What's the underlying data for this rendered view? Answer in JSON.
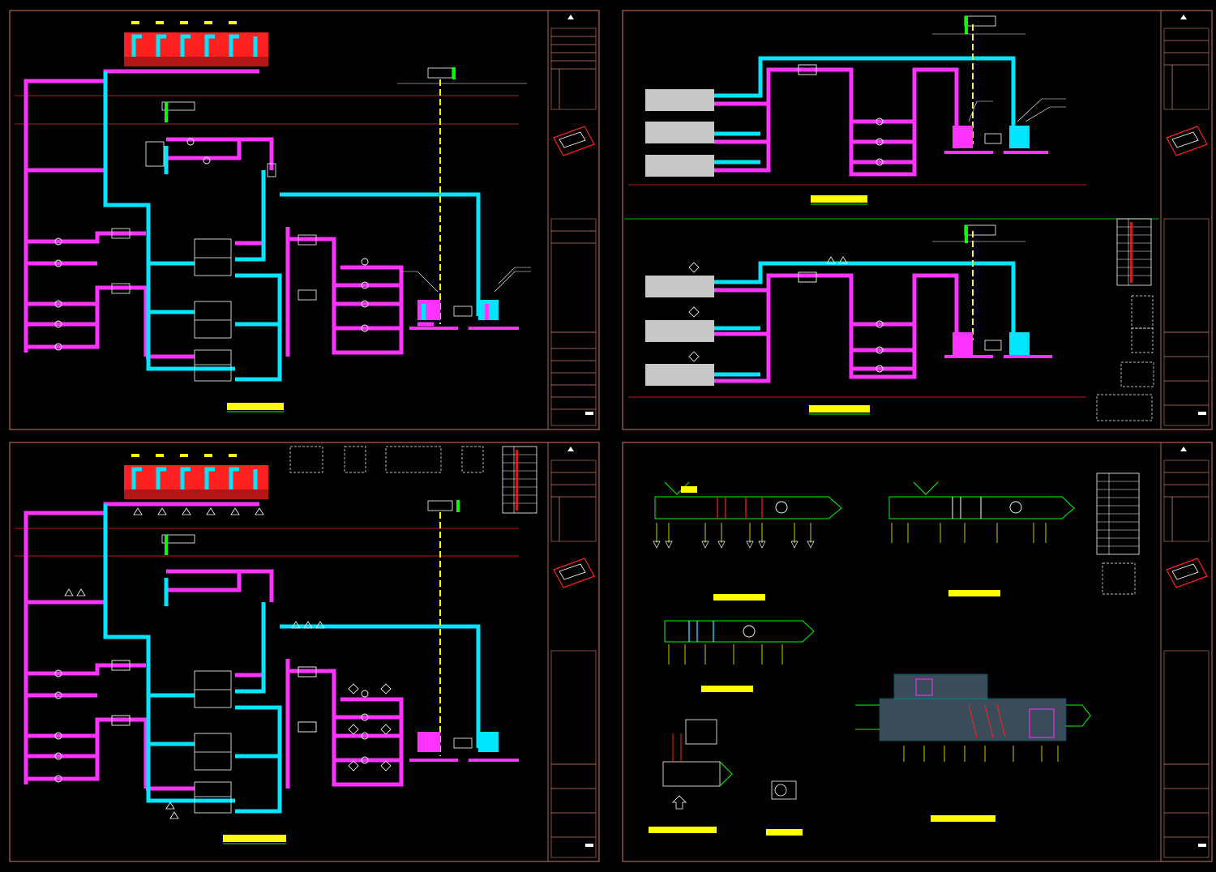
{
  "colors": {
    "background": "#000000",
    "frame": "#b5654f",
    "chilled_water": "#00e5ff",
    "cooling_water": "#ff33ff",
    "cooling_tower": "#ff2020",
    "expansion": "#ffff00",
    "control": "#ffffff",
    "ahu_casing": "#00ff00",
    "equipment_fill": "#c8c8c8",
    "title_bg": "#ffff00",
    "red_line": "#ff2020"
  },
  "icons": [
    "north-arrow-icon",
    "key-plan-icon",
    "pump-icon",
    "valve-icon",
    "fan-icon",
    "sensor-icon"
  ]
}
